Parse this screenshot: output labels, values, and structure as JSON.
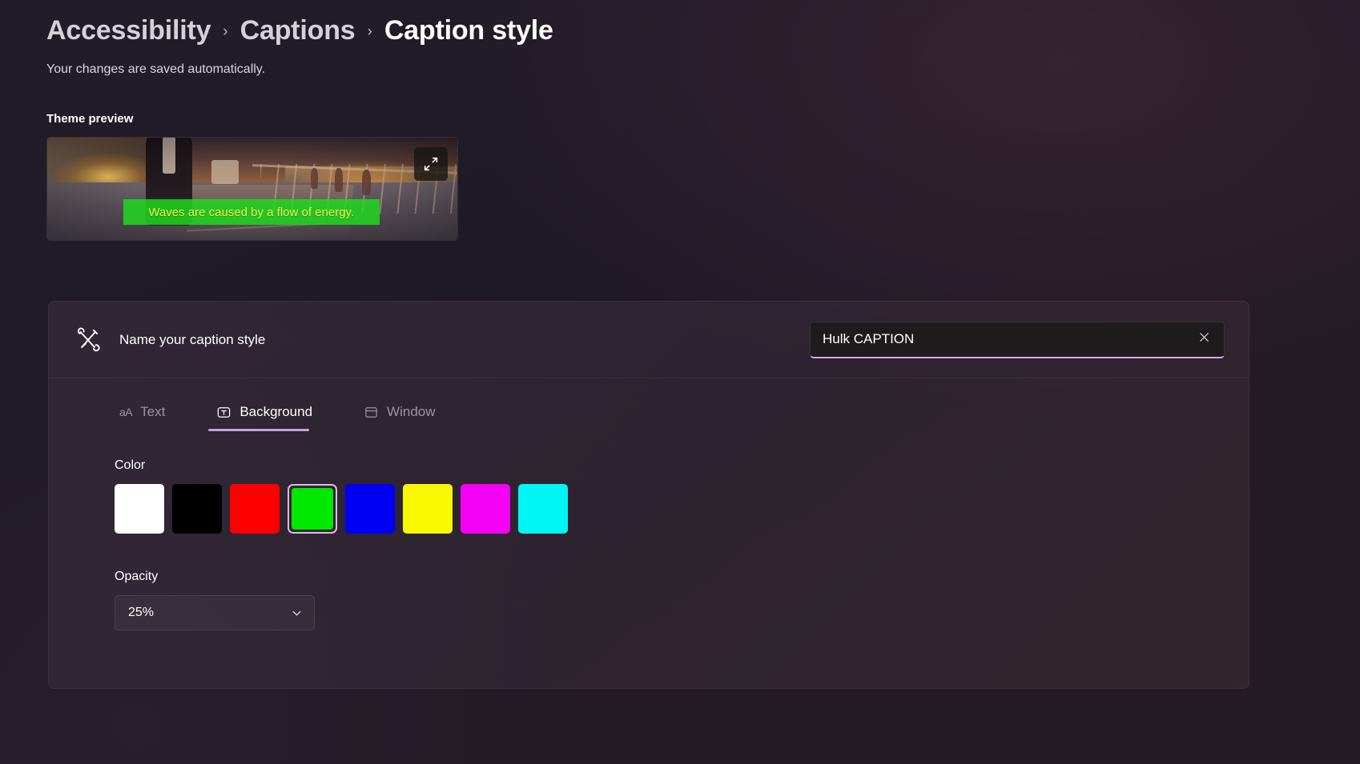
{
  "breadcrumb": {
    "items": [
      {
        "label": "Accessibility",
        "current": false
      },
      {
        "label": "Captions",
        "current": false
      },
      {
        "label": "Caption style",
        "current": true
      }
    ],
    "separator": "›"
  },
  "subtitle": "Your changes are saved automatically.",
  "preview": {
    "section_label": "Theme preview",
    "caption_text": "Waves are caused by a flow of energy.",
    "caption_background_color": "#1DDD1D",
    "caption_text_color": "#E8F542",
    "expand_button_name": "expand-preview-button",
    "expand_icon": "expand-diagonal-icon"
  },
  "card": {
    "header": {
      "icon": "caption-style-brush-icon",
      "label": "Name your caption style",
      "input": {
        "value": "Hulk CAPTION",
        "placeholder": "Name your caption style",
        "clear_icon": "close-icon",
        "focus_underline_color": "#D7A8E8"
      }
    },
    "tabs": [
      {
        "label": "Text",
        "icon": "aa-text-icon",
        "icon_glyph": "aA",
        "active": false
      },
      {
        "label": "Background",
        "icon": "text-in-box-icon",
        "active": true
      },
      {
        "label": "Window",
        "icon": "window-frame-icon",
        "active": false
      }
    ],
    "color": {
      "label": "Color",
      "swatches": [
        {
          "name": "white",
          "hex": "#FFFFFF",
          "selected": false
        },
        {
          "name": "black",
          "hex": "#000000",
          "selected": false
        },
        {
          "name": "red",
          "hex": "#FE0000",
          "selected": false
        },
        {
          "name": "green",
          "hex": "#00E800",
          "selected": true
        },
        {
          "name": "blue",
          "hex": "#0000F5",
          "selected": false
        },
        {
          "name": "yellow",
          "hex": "#F8F800",
          "selected": false
        },
        {
          "name": "magenta",
          "hex": "#F400F4",
          "selected": false
        },
        {
          "name": "cyan",
          "hex": "#00F5F5",
          "selected": false
        }
      ],
      "selection_ring_color": "#DCB9EC"
    },
    "opacity": {
      "label": "Opacity",
      "value": "25%",
      "chevron_icon": "chevron-down-icon"
    }
  }
}
